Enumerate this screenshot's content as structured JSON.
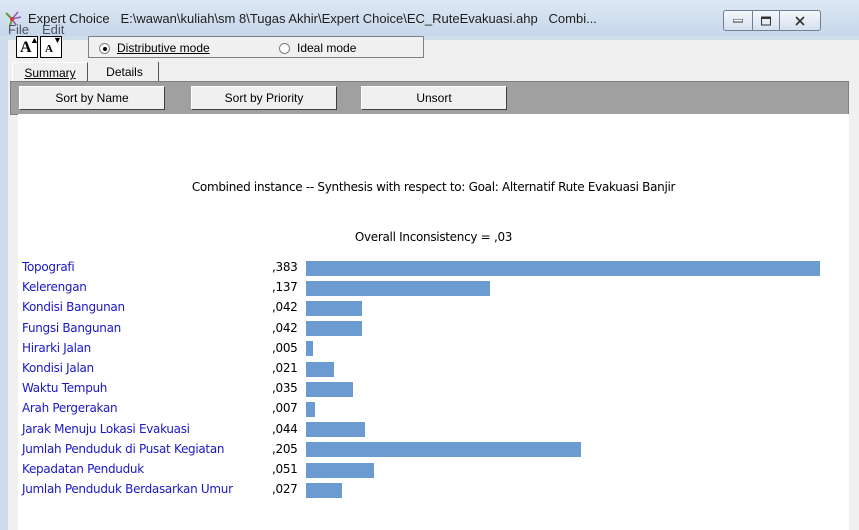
{
  "window": {
    "app_name": "Expert Choice",
    "file_path": "E:\\wawan\\kuliah\\sm 8\\Tugas Akhir\\Expert Choice\\EC_RuteEvakuasi.ahp",
    "window_suffix": "Combi..."
  },
  "menu": [
    "File",
    "Edit"
  ],
  "toolbar": {
    "font_increase_label": "A",
    "font_decrease_label": "A",
    "mode_options": [
      {
        "label": "Distributive mode",
        "selected": true
      },
      {
        "label": "Ideal mode",
        "selected": false
      }
    ]
  },
  "tabs": [
    {
      "label": "Summary",
      "active": true
    },
    {
      "label": "Details",
      "active": false
    }
  ],
  "sort_buttons": [
    {
      "label": "Sort by Name"
    },
    {
      "label": "Sort by Priority"
    },
    {
      "label": "Unsort"
    }
  ],
  "synthesis": {
    "title": "Combined instance -- Synthesis with respect to: Goal: Alternatif Rute Evakuasi Banjir",
    "inconsistency": "Overall Inconsistency = ,03"
  },
  "chart_data": {
    "type": "bar",
    "categories": [
      "Topografi",
      "Kelerengan",
      "Kondisi Bangunan",
      "Fungsi Bangunan",
      "Hirarki Jalan",
      "Kondisi Jalan",
      "Waktu Tempuh",
      "Arah Pergerakan",
      "Jarak Menuju Lokasi Evakuasi",
      "Jumlah Penduduk di Pusat Kegiatan",
      "Kepadatan Penduduk",
      "Jumlah Penduduk Berdasarkan Umur"
    ],
    "values": [
      0.383,
      0.137,
      0.042,
      0.042,
      0.005,
      0.021,
      0.035,
      0.007,
      0.044,
      0.205,
      0.051,
      0.027
    ],
    "value_labels": [
      ",383",
      ",137",
      ",042",
      ",042",
      ",005",
      ",021",
      ",035",
      ",007",
      ",044",
      ",205",
      ",051",
      ",027"
    ],
    "bar_color": "#6b9bd1",
    "xlim": [
      0,
      0.383
    ]
  }
}
